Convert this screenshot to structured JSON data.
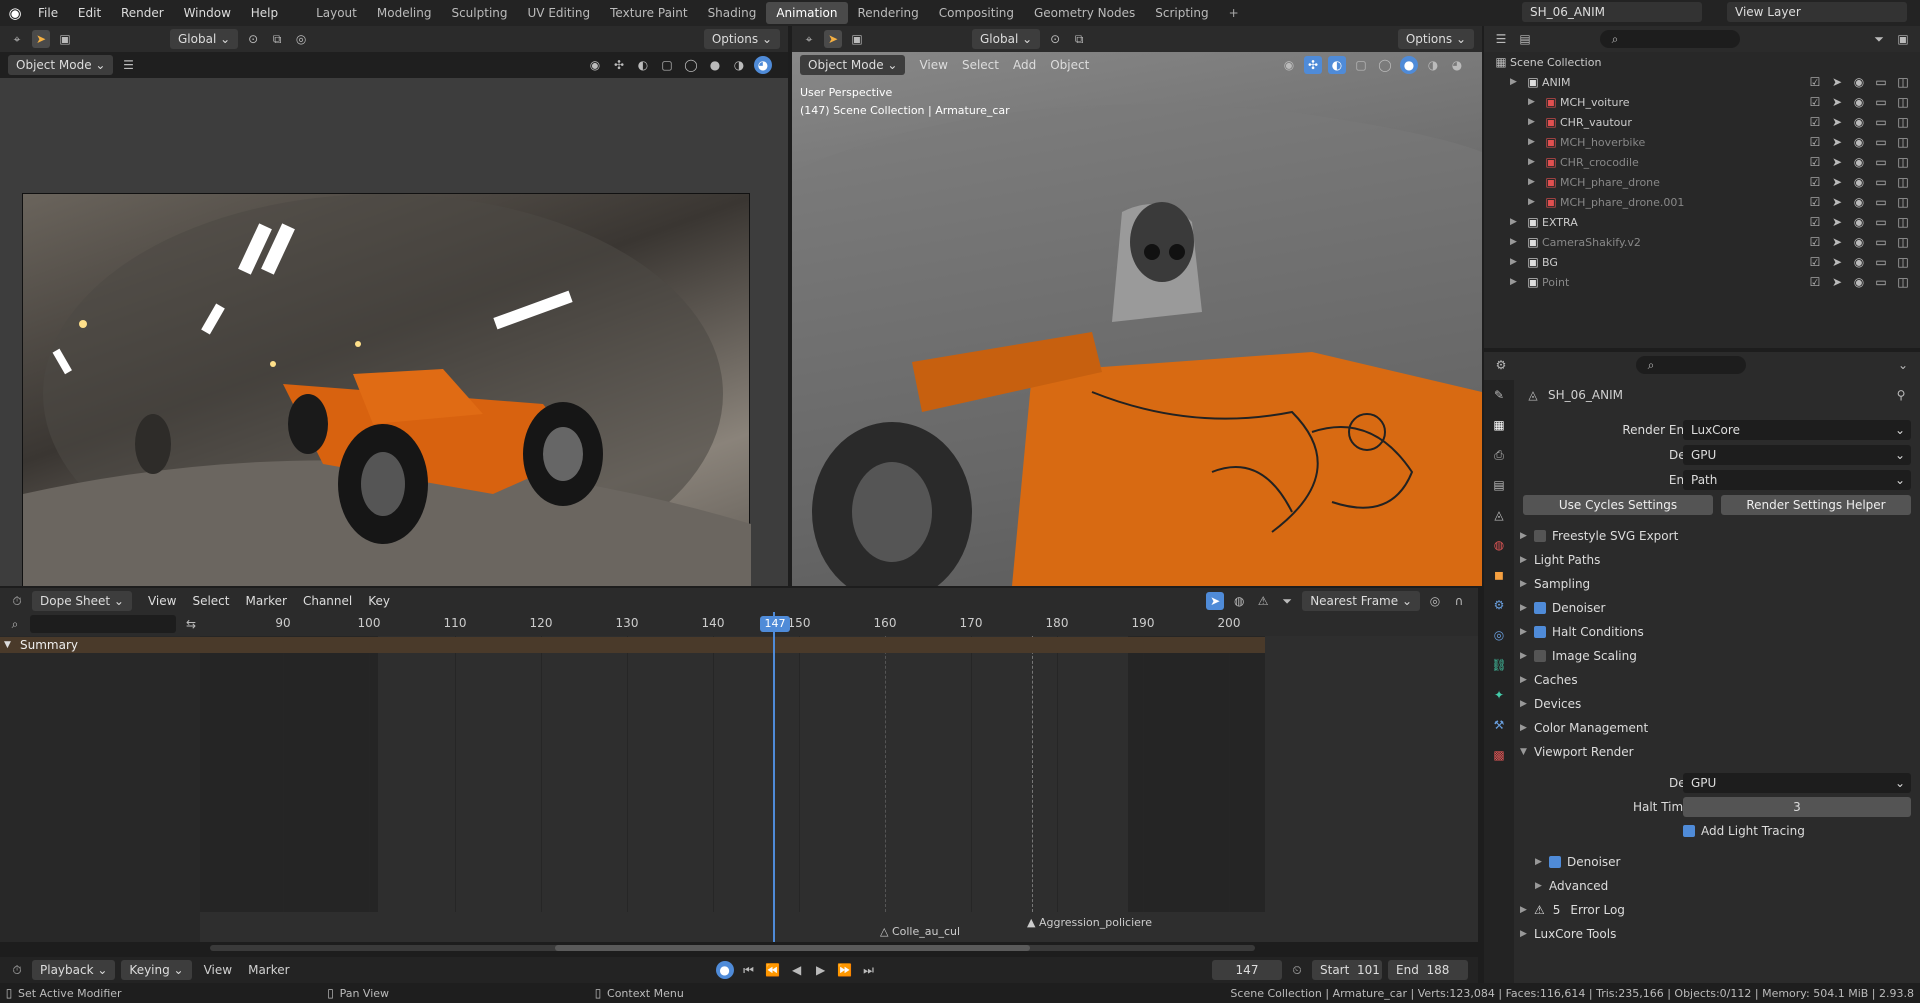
{
  "menu": {
    "items": [
      "File",
      "Edit",
      "Render",
      "Window",
      "Help"
    ]
  },
  "workspaces": [
    "Layout",
    "Modeling",
    "Sculpting",
    "UV Editing",
    "Texture Paint",
    "Shading",
    "Animation",
    "Rendering",
    "Compositing",
    "Geometry Nodes",
    "Scripting"
  ],
  "active_workspace": "Animation",
  "scene_name": "SH_06_ANIM",
  "view_layer": "View Layer",
  "left_viewport": {
    "mode": "Object Mode",
    "orientation": "Global",
    "options": "Options"
  },
  "right_viewport": {
    "mode": "Object Mode",
    "menus": [
      "View",
      "Select",
      "Add",
      "Object"
    ],
    "orientation": "Global",
    "options": "Options",
    "overlay_line1": "User Perspective",
    "overlay_line2": "(147) Scene Collection | Armature_car"
  },
  "dopesheet": {
    "editor": "Dope Sheet",
    "menus": [
      "View",
      "Select",
      "Marker",
      "Channel",
      "Key"
    ],
    "snap": "Nearest Frame",
    "summary": "Summary",
    "ticks": [
      "90",
      "100",
      "110",
      "120",
      "130",
      "140",
      "150",
      "160",
      "170",
      "180",
      "190",
      "200"
    ],
    "current_frame": "147",
    "markers": [
      "Colle_au_cul",
      "Aggression_policiere"
    ]
  },
  "timeline": {
    "menus": [
      "Playback",
      "Keying",
      "View",
      "Marker"
    ],
    "frame": "147",
    "start_label": "Start",
    "start": "101",
    "end_label": "End",
    "end": "188"
  },
  "outliner": {
    "root": "Scene Collection",
    "rows": [
      {
        "name": "ANIM",
        "indent": 1,
        "dim": false
      },
      {
        "name": "MCH_voiture",
        "indent": 2,
        "dim": false
      },
      {
        "name": "CHR_vautour",
        "indent": 2,
        "dim": false
      },
      {
        "name": "MCH_hoverbike",
        "indent": 2,
        "dim": true
      },
      {
        "name": "CHR_crocodile",
        "indent": 2,
        "dim": true
      },
      {
        "name": "MCH_phare_drone",
        "indent": 2,
        "dim": true
      },
      {
        "name": "MCH_phare_drone.001",
        "indent": 2,
        "dim": true
      },
      {
        "name": "EXTRA",
        "indent": 1,
        "dim": false
      },
      {
        "name": "CameraShakify.v2",
        "indent": 1,
        "dim": true
      },
      {
        "name": "BG",
        "indent": 1,
        "dim": false
      },
      {
        "name": "Point",
        "indent": 1,
        "dim": true
      }
    ]
  },
  "properties": {
    "scene": "SH_06_ANIM",
    "render_engine_label": "Render Engine",
    "render_engine": "LuxCore",
    "device_label": "Device",
    "device": "GPU",
    "engine_label": "Engine",
    "engine": "Path",
    "btn_cycles": "Use Cycles Settings",
    "btn_helper": "Render Settings Helper",
    "sections": [
      {
        "label": "Freestyle SVG Export",
        "checkbox": "off",
        "open": false
      },
      {
        "label": "Light Paths",
        "checkbox": "none",
        "open": false
      },
      {
        "label": "Sampling",
        "checkbox": "none",
        "open": false
      },
      {
        "label": "Denoiser",
        "checkbox": "on",
        "open": false
      },
      {
        "label": "Halt Conditions",
        "checkbox": "on",
        "open": false
      },
      {
        "label": "Image Scaling",
        "checkbox": "off",
        "open": false
      },
      {
        "label": "Caches",
        "checkbox": "none",
        "open": false
      },
      {
        "label": "Devices",
        "checkbox": "none",
        "open": false
      },
      {
        "label": "Color Management",
        "checkbox": "none",
        "open": false
      },
      {
        "label": "Viewport Render",
        "checkbox": "none",
        "open": true
      }
    ],
    "vp_device_label": "Device",
    "vp_device": "GPU",
    "halt_label": "Halt Time (s)",
    "halt_value": "3",
    "add_light": "Add Light Tracing",
    "sub_denoiser": "Denoiser",
    "sub_advanced": "Advanced",
    "error_count": "5",
    "error_log": "Error Log",
    "luxcore_tools": "LuxCore Tools"
  },
  "status": {
    "left1": "Set Active Modifier",
    "left2": "Pan View",
    "left3": "Context Menu",
    "right": "Scene Collection | Armature_car | Verts:123,084 | Faces:116,614 | Tris:235,166 | Objects:0/112 | Memory: 504.1 MiB | 2.93.8"
  }
}
